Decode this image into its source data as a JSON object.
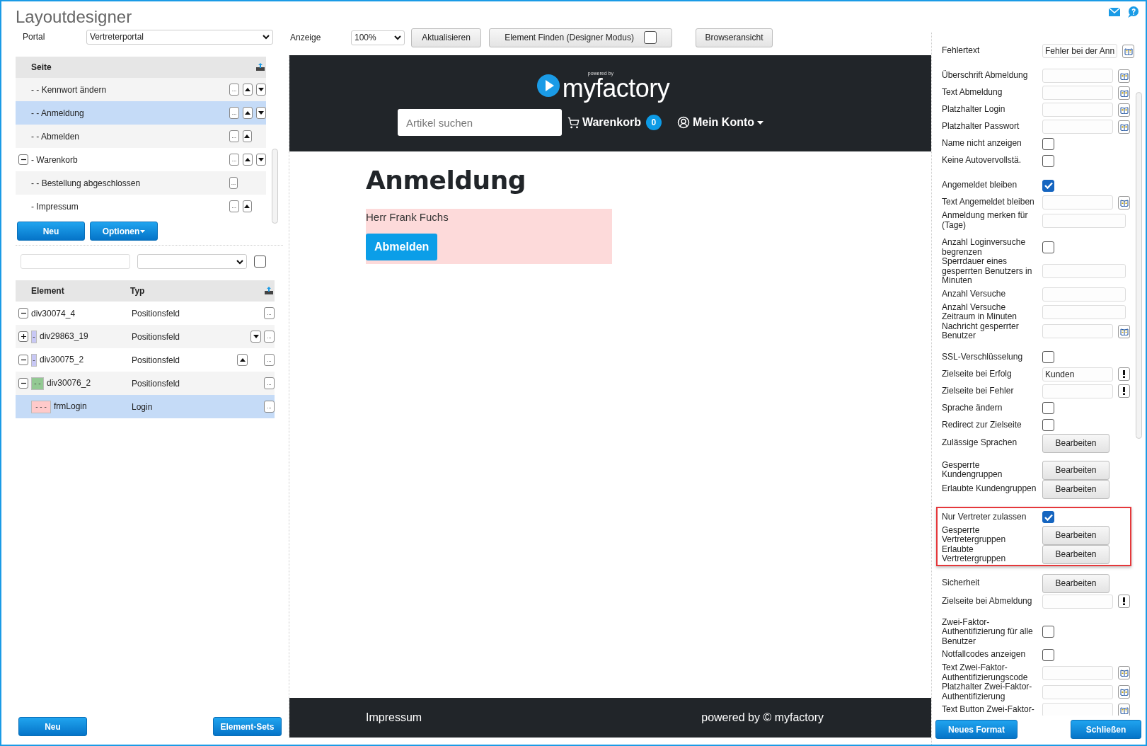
{
  "title": "Layoutdesigner",
  "portal": {
    "label": "Portal",
    "value": "Vertreterportal"
  },
  "pages": {
    "header": "Seite",
    "items": [
      {
        "label": "- - Kennwort ändern",
        "more": "...",
        "up": true,
        "down": true,
        "selected": false
      },
      {
        "label": "- - Anmeldung",
        "more": "...",
        "up": true,
        "down": true,
        "selected": true
      },
      {
        "label": "- - Abmelden",
        "more": "...",
        "up": true,
        "down": false,
        "selected": false
      },
      {
        "label": "- Warenkorb",
        "more": "...",
        "up": true,
        "down": true,
        "selected": false,
        "expanded": true,
        "children": [
          {
            "label": "- - Bestellung abgeschlossen",
            "more": "...",
            "up": false,
            "down": false,
            "selected": false
          }
        ]
      },
      {
        "label": "- Impressum",
        "more": "...",
        "up": true,
        "down": false,
        "selected": false
      }
    ]
  },
  "page_buttons": [
    {
      "label": "Neu",
      "kind": "plain"
    },
    {
      "label": "Optionen",
      "kind": "menu"
    }
  ],
  "filter": {
    "checked": false
  },
  "elements": {
    "columns": [
      "Element",
      "Typ"
    ],
    "rows": [
      {
        "name": "div30074_4",
        "type": "Positionsfeld",
        "more": "...",
        "expanded": true,
        "up": false,
        "down": false,
        "selected": false,
        "children": [
          {
            "name": "div29863_19",
            "type": "Positionsfeld",
            "more": "...",
            "expanded": false,
            "marker": "-",
            "color": "#c8c8f5",
            "up": false,
            "down": true,
            "selected": false
          },
          {
            "name": "div30075_2",
            "type": "Positionsfeld",
            "more": "...",
            "expanded": true,
            "marker": "-",
            "color": "#c8c8f5",
            "up": true,
            "down": false,
            "selected": false,
            "children": [
              {
                "name": "div30076_2",
                "type": "Positionsfeld",
                "more": "...",
                "expanded": true,
                "marker": "- -",
                "color": "#93c993",
                "up": false,
                "down": false,
                "selected": false,
                "children": [
                  {
                    "name": "frmLogin",
                    "type": "Login",
                    "more": "...",
                    "marker": "- - -",
                    "color": "#ffcaca",
                    "up": false,
                    "down": false,
                    "selected": true
                  }
                ]
              }
            ]
          }
        ]
      }
    ]
  },
  "left_buttons": [
    "Neu",
    "Element-Sets"
  ],
  "toolbar": {
    "zoom_label": "Anzeige",
    "zoom": "100%",
    "refresh": "Aktualisieren",
    "find": {
      "label": "Element Finden (Designer Modus)",
      "checked": false
    },
    "browser": "Browseransicht"
  },
  "preview": {
    "logo_small": "powered by",
    "logo": "myfactory",
    "search_placeholder": "Artikel suchen",
    "cart": "Warenkorb",
    "cart_count": "0",
    "account": "Mein Konto",
    "heading": "Anmeldung",
    "user": "Herr Frank Fuchs",
    "logout": "Abmelden",
    "footer_left": "Impressum",
    "footer_right": "powered by © myfactory"
  },
  "properties": [
    {
      "highlighted": false,
      "rows": [
        {
          "kind": "text",
          "label": "Fehlertext",
          "value": "Fehler bei der Ann",
          "translatable": true
        }
      ]
    },
    {
      "highlighted": false,
      "rows": [
        {
          "kind": "text",
          "label": "Überschrift Abmeldung",
          "translatable": true
        },
        {
          "kind": "text",
          "label": "Text Abmeldung",
          "translatable": true
        },
        {
          "kind": "text",
          "label": "Platzhalter Login",
          "translatable": true
        },
        {
          "kind": "text",
          "label": "Platzhalter Passwort",
          "translatable": true
        },
        {
          "kind": "checkbox",
          "label": "Name nicht anzeigen",
          "checked": false
        },
        {
          "kind": "checkbox",
          "label": "Keine Autovervollstä.",
          "checked": false
        }
      ]
    },
    {
      "highlighted": false,
      "rows": [
        {
          "kind": "checkbox",
          "label": "Angemeldet bleiben",
          "checked": true
        },
        {
          "kind": "text",
          "label": "Text Angemeldet bleiben",
          "translatable": true
        },
        {
          "kind": "text",
          "label": "Anmeldung merken für (Tage)"
        }
      ]
    },
    {
      "highlighted": false,
      "rows": [
        {
          "kind": "checkbox",
          "label": "Anzahl Loginversuche begrenzen",
          "checked": false
        },
        {
          "kind": "text",
          "label": "Sperrdauer eines gesperrten Benutzers in Minuten"
        },
        {
          "kind": "text",
          "label": "Anzahl Versuche"
        },
        {
          "kind": "text",
          "label": "Anzahl Versuche Zeitraum in Minuten"
        },
        {
          "kind": "text",
          "label": "Nachricht gesperrter Benutzer",
          "translatable": true
        }
      ]
    },
    {
      "highlighted": false,
      "rows": [
        {
          "kind": "checkbox",
          "label": "SSL-Verschlüsselung",
          "checked": false
        },
        {
          "kind": "text",
          "label": "Zielseite bei Erfolg",
          "value": "Kunden",
          "page_link": true
        },
        {
          "kind": "text",
          "label": "Zielseite bei Fehler",
          "page_link": true
        },
        {
          "kind": "checkbox",
          "label": "Sprache ändern",
          "checked": false
        },
        {
          "kind": "checkbox",
          "label": "Redirect zur Zielseite",
          "checked": false
        },
        {
          "kind": "button",
          "label": "Zulässige Sprachen",
          "button": "Bearbeiten"
        }
      ]
    },
    {
      "highlighted": false,
      "rows": [
        {
          "kind": "button",
          "label": "Gesperrte Kundengruppen",
          "button": "Bearbeiten"
        },
        {
          "kind": "button",
          "label": "Erlaubte Kundengruppen",
          "button": "Bearbeiten"
        }
      ]
    },
    {
      "highlighted": true,
      "rows": [
        {
          "kind": "checkbox",
          "label": "Nur Vertreter zulassen",
          "checked": true
        },
        {
          "kind": "button",
          "label": "Gesperrte Vertretergruppen",
          "button": "Bearbeiten"
        },
        {
          "kind": "button",
          "label": "Erlaubte Vertretergruppen",
          "button": "Bearbeiten"
        }
      ]
    },
    {
      "highlighted": false,
      "rows": [
        {
          "kind": "button",
          "label": "Sicherheit",
          "button": "Bearbeiten"
        },
        {
          "kind": "text",
          "label": "Zielseite bei Abmeldung",
          "page_link": true
        }
      ]
    },
    {
      "highlighted": false,
      "rows": [
        {
          "kind": "checkbox",
          "label": "Zwei-Faktor-Authentifizierung für alle Benutzer",
          "checked": false
        },
        {
          "kind": "checkbox",
          "label": "Notfallcodes anzeigen",
          "checked": false
        },
        {
          "kind": "text",
          "label": "Text Zwei-Faktor-Authentifizierungscode",
          "translatable": true
        },
        {
          "kind": "text",
          "label": "Platzhalter Zwei-Faktor-Authentifizierung",
          "translatable": true
        },
        {
          "kind": "text",
          "label": "Text Button Zwei-Faktor-",
          "translatable": true
        }
      ]
    }
  ],
  "right_buttons": [
    "Neues Format",
    "Schließen"
  ]
}
